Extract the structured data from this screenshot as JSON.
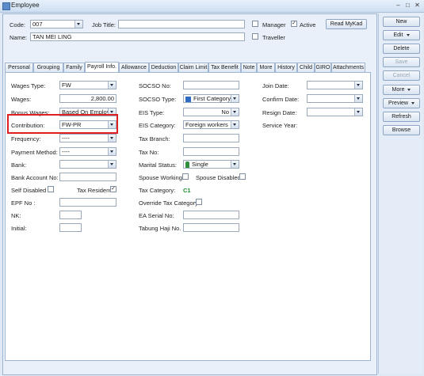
{
  "window": {
    "title": "Employee"
  },
  "header": {
    "code_label": "Code:",
    "code_value": "007",
    "job_title_label": "Job Title:",
    "job_title_value": "",
    "name_label": "Name:",
    "name_value": "TAN MEI LING",
    "manager_label": "Manager",
    "active_label": "Active",
    "traveller_label": "Traveller",
    "mykad_button": "Read MyKad"
  },
  "tabs": [
    "Personal",
    "Grouping",
    "Family",
    "Payroll Info.",
    "Allowance",
    "Deduction",
    "Claim Limit",
    "Tax Benefit",
    "Note",
    "More",
    "History",
    "Child",
    "GIRO",
    "Attachments"
  ],
  "active_tab": "Payroll Info.",
  "col1": {
    "wages_type_label": "Wages Type:",
    "wages_type": "FW",
    "wages_label": "Wages:",
    "wages": "2,800.00",
    "bonus_wages_label": "Bonus Wages:",
    "bonus_wages": "Based On Employe",
    "contribution_label": "Contribution:",
    "contribution": "FW-PR",
    "frequency_label": "Frequency:",
    "frequency": "----",
    "payment_method_label": "Payment Method:",
    "payment_method": "----",
    "bank_label": "Bank:",
    "bank": "",
    "bank_account_label": "Bank Account No:",
    "bank_account": "",
    "self_disabled_label": "Self Disabled",
    "tax_resident_label": "Tax Resident",
    "epf_label": "EPF No :",
    "nk_label": "NK:",
    "initial_label": "Initial:"
  },
  "col2": {
    "socso_no_label": "SOCSO No:",
    "socso_type_label": "SOCSO Type:",
    "socso_type": "First Category",
    "eis_type_label": "EIS Type:",
    "eis_type": "No",
    "eis_category_label": "EIS Category:",
    "eis_category": "Foreign workers",
    "tax_branch_label": "Tax Branch:",
    "tax_no_label": "Tax No:",
    "marital_status_label": "Marital Status:",
    "marital_status": "Single",
    "spouse_working_label": "Spouse Working",
    "spouse_disabled_label": "Spouse Disabled",
    "tax_category_label": "Tax Category:",
    "tax_category": "C1",
    "override_tax_label": "Override Tax Category",
    "ea_serial_label": "EA Serial No:",
    "tabung_haji_label": "Tabung Haji No."
  },
  "col3": {
    "join_date_label": "Join Date:",
    "confirm_date_label": "Confirm Date:",
    "resign_date_label": "Resign Date:",
    "service_year_label": "Service Year:"
  },
  "right_buttons": {
    "new": "New",
    "edit": "Edit",
    "delete": "Delete",
    "save": "Save",
    "cancel": "Cancel",
    "more": "More",
    "preview": "Preview",
    "refresh": "Refresh",
    "browse": "Browse"
  },
  "colors": {
    "highlight": "#e02020",
    "accent": "#5b8bc9"
  }
}
